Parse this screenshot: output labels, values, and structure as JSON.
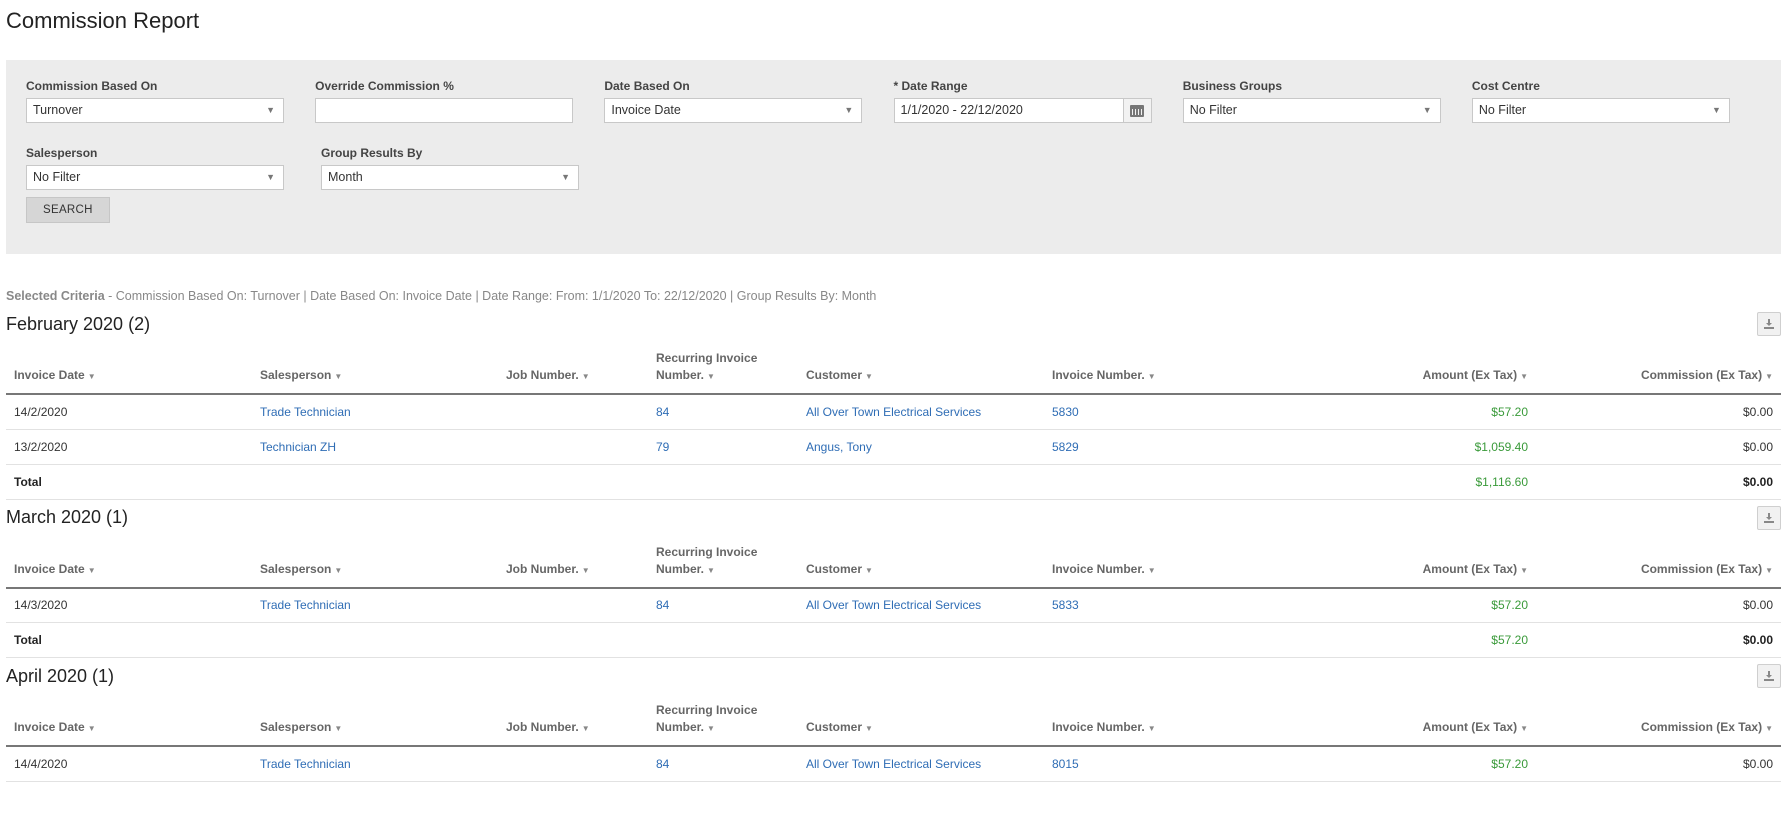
{
  "page_title": "Commission Report",
  "filters": {
    "commission_based_on": {
      "label": "Commission Based On",
      "value": "Turnover"
    },
    "override_commission": {
      "label": "Override Commission %",
      "value": ""
    },
    "date_based_on": {
      "label": "Date Based On",
      "value": "Invoice Date"
    },
    "date_range": {
      "label": "* Date Range",
      "value": "1/1/2020 - 22/12/2020"
    },
    "business_groups": {
      "label": "Business Groups",
      "value": "No Filter"
    },
    "cost_centre": {
      "label": "Cost Centre",
      "value": "No Filter"
    },
    "salesperson": {
      "label": "Salesperson",
      "value": "No Filter"
    },
    "group_results_by": {
      "label": "Group Results By",
      "value": "Month"
    },
    "search_label": "SEARCH"
  },
  "criteria": {
    "label": "Selected Criteria",
    "text": " - Commission Based On: Turnover | Date Based On: Invoice Date | Date Range: From: 1/1/2020 To: 22/12/2020 | Group Results By: Month"
  },
  "columns": {
    "invoice_date": "Invoice Date",
    "salesperson": "Salesperson",
    "job_number": "Job Number.",
    "recurring_1": "Recurring Invoice",
    "recurring_2": "Number.",
    "customer": "Customer",
    "invoice_number": "Invoice Number.",
    "amount": "Amount (Ex Tax)",
    "commission": "Commission (Ex Tax)",
    "sort_glyph": "▼"
  },
  "total_label": "Total",
  "groups": [
    {
      "title": "February 2020 (2)",
      "rows": [
        {
          "date": "14/2/2020",
          "salesperson": "Trade Technician",
          "job": "",
          "recurring": "84",
          "customer": "All Over Town Electrical Services",
          "invoice": "5830",
          "amount": "$57.20",
          "commission": "$0.00"
        },
        {
          "date": "13/2/2020",
          "salesperson": "Technician ZH",
          "job": "",
          "recurring": "79",
          "customer": "Angus, Tony",
          "invoice": "5829",
          "amount": "$1,059.40",
          "commission": "$0.00"
        }
      ],
      "total_amount": "$1,116.60",
      "total_commission": "$0.00"
    },
    {
      "title": "March 2020 (1)",
      "rows": [
        {
          "date": "14/3/2020",
          "salesperson": "Trade Technician",
          "job": "",
          "recurring": "84",
          "customer": "All Over Town Electrical Services",
          "invoice": "5833",
          "amount": "$57.20",
          "commission": "$0.00"
        }
      ],
      "total_amount": "$57.20",
      "total_commission": "$0.00"
    },
    {
      "title": "April 2020 (1)",
      "rows": [
        {
          "date": "14/4/2020",
          "salesperson": "Trade Technician",
          "job": "",
          "recurring": "84",
          "customer": "All Over Town Electrical Services",
          "invoice": "8015",
          "amount": "$57.20",
          "commission": "$0.00"
        }
      ]
    }
  ]
}
